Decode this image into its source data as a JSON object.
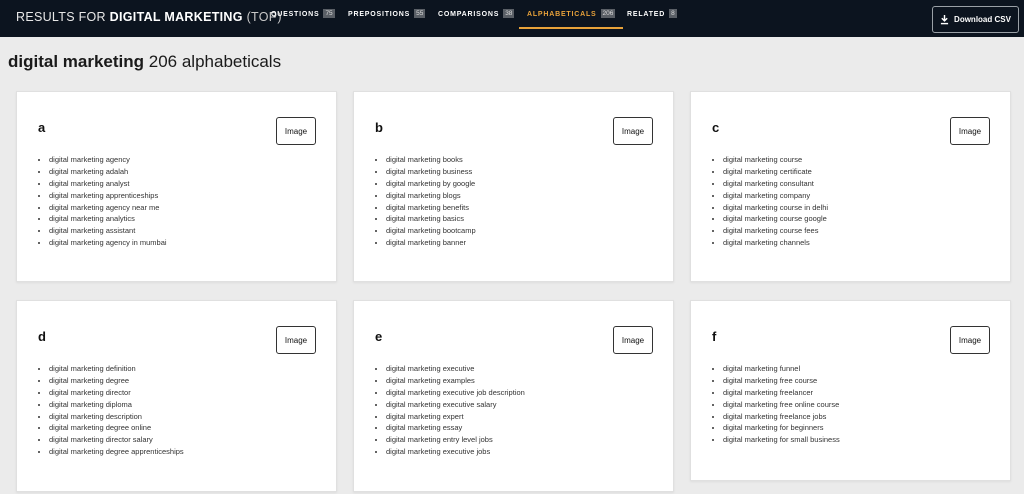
{
  "header": {
    "results_prefix": "RESULTS FOR",
    "query": "DIGITAL MARKETING",
    "suffix": "(TOP)",
    "tabs": [
      {
        "label": "QUESTIONS",
        "count": "75"
      },
      {
        "label": "PREPOSITIONS",
        "count": "55"
      },
      {
        "label": "COMPARISONS",
        "count": "38"
      },
      {
        "label": "ALPHABETICALS",
        "count": "206"
      },
      {
        "label": "RELATED",
        "count": "8"
      }
    ],
    "download_label": "Download CSV",
    "download_icon": "download-icon",
    "active_color": "#e8a23a"
  },
  "page": {
    "query": "digital marketing",
    "summary": "206 alphabeticals"
  },
  "cards": [
    {
      "letter": "a",
      "button": "Image",
      "items": [
        "digital marketing agency",
        "digital marketing adalah",
        "digital marketing analyst",
        "digital marketing apprenticeships",
        "digital marketing agency near me",
        "digital marketing analytics",
        "digital marketing assistant",
        "digital marketing agency in mumbai"
      ]
    },
    {
      "letter": "b",
      "button": "Image",
      "items": [
        "digital marketing books",
        "digital marketing business",
        "digital marketing by google",
        "digital marketing blogs",
        "digital marketing benefits",
        "digital marketing basics",
        "digital marketing bootcamp",
        "digital marketing banner"
      ]
    },
    {
      "letter": "c",
      "button": "Image",
      "items": [
        "digital marketing course",
        "digital marketing certificate",
        "digital marketing consultant",
        "digital marketing company",
        "digital marketing course in delhi",
        "digital marketing course google",
        "digital marketing course fees",
        "digital marketing channels"
      ]
    },
    {
      "letter": "d",
      "button": "Image",
      "items": [
        "digital marketing definition",
        "digital marketing degree",
        "digital marketing director",
        "digital marketing diploma",
        "digital marketing description",
        "digital marketing degree online",
        "digital marketing director salary",
        "digital marketing degree apprenticeships"
      ]
    },
    {
      "letter": "e",
      "button": "Image",
      "items": [
        "digital marketing executive",
        "digital marketing examples",
        "digital marketing executive job description",
        "digital marketing executive salary",
        "digital marketing expert",
        "digital marketing essay",
        "digital marketing entry level jobs",
        "digital marketing executive jobs"
      ]
    },
    {
      "letter": "f",
      "button": "Image",
      "items": [
        "digital marketing funnel",
        "digital marketing free course",
        "digital marketing freelancer",
        "digital marketing free online course",
        "digital marketing freelance jobs",
        "digital marketing for beginners",
        "digital marketing for small business"
      ]
    }
  ]
}
